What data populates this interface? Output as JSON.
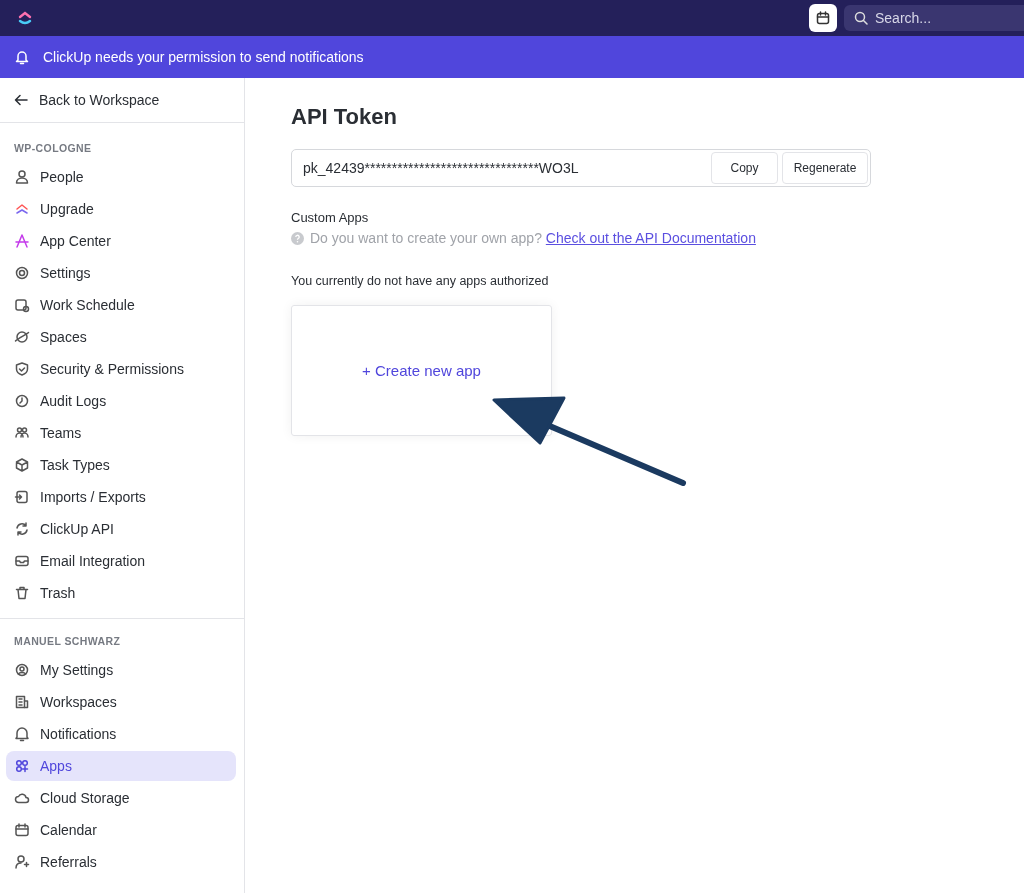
{
  "top_bar": {
    "search": {
      "placeholder": "Search..."
    }
  },
  "notification_banner": {
    "text": "ClickUp needs your permission to send notifications"
  },
  "sidebar": {
    "back_link": "Back to Workspace",
    "sections": [
      {
        "title": "WP-COLOGNE",
        "items": [
          {
            "label": "People",
            "selected": false
          },
          {
            "label": "Upgrade",
            "selected": false
          },
          {
            "label": "App Center",
            "selected": false
          },
          {
            "label": "Settings",
            "selected": false
          },
          {
            "label": "Work Schedule",
            "selected": false
          },
          {
            "label": "Spaces",
            "selected": false
          },
          {
            "label": "Security & Permissions",
            "selected": false
          },
          {
            "label": "Audit Logs",
            "selected": false
          },
          {
            "label": "Teams",
            "selected": false
          },
          {
            "label": "Task Types",
            "selected": false
          },
          {
            "label": "Imports / Exports",
            "selected": false
          },
          {
            "label": "ClickUp API",
            "selected": false
          },
          {
            "label": "Email Integration",
            "selected": false
          },
          {
            "label": "Trash",
            "selected": false
          }
        ]
      },
      {
        "title": "MANUEL SCHWARZ",
        "items": [
          {
            "label": "My Settings",
            "selected": false
          },
          {
            "label": "Workspaces",
            "selected": false
          },
          {
            "label": "Notifications",
            "selected": false
          },
          {
            "label": "Apps",
            "selected": true
          },
          {
            "label": "Cloud Storage",
            "selected": false
          },
          {
            "label": "Calendar",
            "selected": false
          },
          {
            "label": "Referrals",
            "selected": false
          }
        ]
      }
    ]
  },
  "main": {
    "title": "API Token",
    "token": {
      "value": "pk_42439********************************WO3L",
      "buttons": [
        "Copy",
        "Regenerate"
      ]
    },
    "custom_apps": {
      "heading": "Custom Apps",
      "hint": "Do you want to create your own app?",
      "link": "Check out the API Documentation"
    },
    "empty_message": "You currently do not have any apps authorized",
    "create_card": {
      "label": "+ Create new app"
    }
  }
}
